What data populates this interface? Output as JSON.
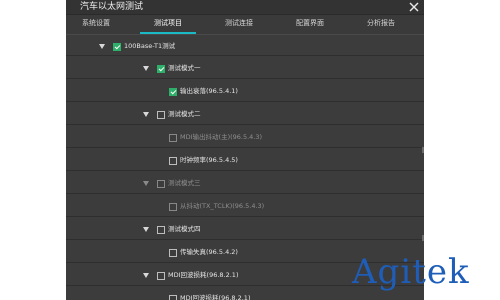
{
  "window": {
    "title": "汽车以太网测试",
    "close_icon": "close-icon"
  },
  "tabs": [
    {
      "label": "系统设置",
      "active": false
    },
    {
      "label": "测试项目",
      "active": true
    },
    {
      "label": "测试连接",
      "active": false
    },
    {
      "label": "配置界面",
      "active": false
    },
    {
      "label": "分析报告",
      "active": false
    }
  ],
  "tree": {
    "root": {
      "label": "100Base-T1测试",
      "checked": true
    },
    "mode1": {
      "label": "测试模式一",
      "checked": true
    },
    "item_9541": {
      "label": "输出衰落(96.5.4.1)",
      "checked": true
    },
    "mode2": {
      "label": "测试模式二",
      "checked": false
    },
    "item_9543_mdi": {
      "label": "MDI输出抖动(主)(96.5.4.3)",
      "checked": false,
      "disabled": true
    },
    "item_9545": {
      "label": "时钟频率(96.5.4.5)",
      "checked": false
    },
    "mode3": {
      "label": "测试模式三",
      "checked": false,
      "disabled": true
    },
    "item_9543_slave": {
      "label": "从抖动(TX_TCLK)(96.5.4.3)",
      "checked": false,
      "disabled": true
    },
    "mode4": {
      "label": "测试模式四",
      "checked": false
    },
    "item_9542": {
      "label": "传输失真(96.5.4.2)",
      "checked": false
    },
    "mdi_return": {
      "label": "MDI回波损耗(96.8.2.1)",
      "checked": false
    },
    "item_9821": {
      "label": "MDI回波损耗(96.8.2.1)",
      "checked": false
    }
  },
  "watermark": {
    "text": "Agitek"
  },
  "colors": {
    "accent": "#19b9c6",
    "check": "#2eaf6a",
    "watermark": "#1e5db8"
  }
}
